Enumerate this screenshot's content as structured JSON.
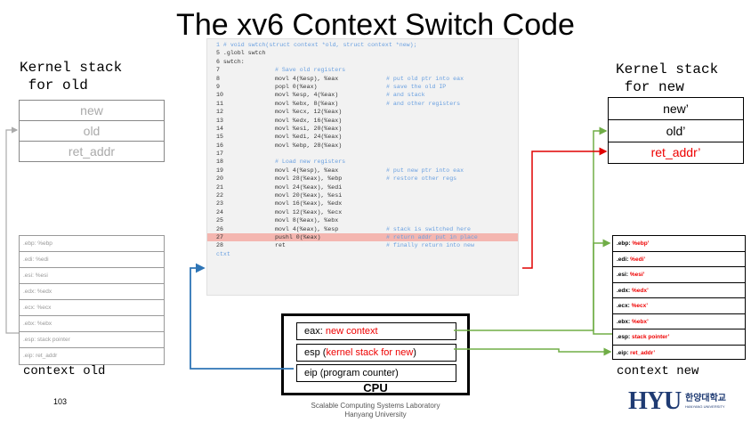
{
  "slide": {
    "title": "The xv6 Context Switch Code",
    "page_number": "103",
    "footer_line1": "Scalable Computing Systems Laboratory",
    "footer_line2": "Hanyang University",
    "logo_text": "HYU",
    "logo_korean": "한양대학교",
    "logo_sub": "HANYANG UNIVERSITY"
  },
  "kernel_old": {
    "label": "Kernel stack\n for old",
    "cells": [
      "new",
      "old",
      "ret_addr"
    ]
  },
  "kernel_new": {
    "label": "Kernel stack\n for new",
    "cells": [
      "new’",
      "old’",
      "ret_addr’"
    ]
  },
  "context_old": {
    "label": "context old",
    "rows": [
      ".ebp: %ebp",
      ".edi: %edi",
      ".esi: %esi",
      ".edx: %edx",
      ".ecx: %ecx",
      ".ebx: %ebx",
      ".esp: stack pointer",
      ".eip: ret_addr"
    ]
  },
  "context_new": {
    "label": "context new",
    "rows": [
      {
        "k": ".ebp: ",
        "v": "%ebp’"
      },
      {
        "k": ".edi: ",
        "v": "%edi’"
      },
      {
        "k": ".esi: ",
        "v": "%esi’"
      },
      {
        "k": ".edx: ",
        "v": "%edx’"
      },
      {
        "k": ".ecx: ",
        "v": "%ecx’"
      },
      {
        "k": ".ebx: ",
        "v": "%ebx’"
      },
      {
        "k": ".esp: ",
        "v": "stack pointer’"
      },
      {
        "k": ".eip: ",
        "v": "ret_addr’"
      }
    ]
  },
  "code": {
    "line1": "1 # void swtch(struct context *old, struct context *new);",
    "line5": "5 .globl swtch",
    "line6": "6 swtch:",
    "lines": [
      {
        "n": "7",
        "op": "# Save old registers",
        "cm": "",
        "c": true
      },
      {
        "n": "8",
        "op": "movl 4(%esp), %eax",
        "cm": "# put old ptr into eax"
      },
      {
        "n": "9",
        "op": "popl 0(%eax)",
        "cm": "# save the old IP"
      },
      {
        "n": "10",
        "op": "movl %esp, 4(%eax)",
        "cm": "# and stack"
      },
      {
        "n": "11",
        "op": "movl %ebx, 8(%eax)",
        "cm": "# and other registers"
      },
      {
        "n": "12",
        "op": "movl %ecx, 12(%eax)",
        "cm": ""
      },
      {
        "n": "13",
        "op": "movl %edx, 16(%eax)",
        "cm": ""
      },
      {
        "n": "14",
        "op": "movl %esi, 20(%eax)",
        "cm": ""
      },
      {
        "n": "15",
        "op": "movl %edi, 24(%eax)",
        "cm": ""
      },
      {
        "n": "16",
        "op": "movl %ebp, 28(%eax)",
        "cm": ""
      },
      {
        "n": "17",
        "op": "",
        "cm": ""
      },
      {
        "n": "18",
        "op": "# Load new registers",
        "cm": "",
        "c": true
      },
      {
        "n": "19",
        "op": "movl 4(%esp), %eax",
        "cm": "# put new ptr into eax"
      },
      {
        "n": "20",
        "op": "movl 28(%eax), %ebp",
        "cm": "# restore other regs"
      },
      {
        "n": "21",
        "op": "movl 24(%eax), %edi",
        "cm": ""
      },
      {
        "n": "22",
        "op": "movl 20(%eax), %esi",
        "cm": ""
      },
      {
        "n": "23",
        "op": "movl 16(%eax), %edx",
        "cm": ""
      },
      {
        "n": "24",
        "op": "movl 12(%eax), %ecx",
        "cm": ""
      },
      {
        "n": "25",
        "op": "movl 8(%eax), %ebx",
        "cm": ""
      },
      {
        "n": "26",
        "op": "movl 4(%eax), %esp",
        "cm": "# stack is switched here"
      },
      {
        "n": "27",
        "op": "pushl 0(%eax)",
        "cm": "# return addr put in place",
        "hl": true
      },
      {
        "n": "28",
        "op": "ret",
        "cm": "# finally return into new"
      }
    ],
    "last": "ctxt"
  },
  "cpu": {
    "label": "CPU",
    "eax_name": "eax: ",
    "eax_val": "new context",
    "esp_name": "esp (",
    "esp_val": "kernel stack for new",
    "esp_close": ")",
    "eip_text": "eip (program counter)"
  },
  "colors": {
    "red": "#e00000",
    "green": "#70ad47",
    "blue": "#2e75b6",
    "gray": "#aaaaaa",
    "highlight": "#f4b6b0"
  }
}
